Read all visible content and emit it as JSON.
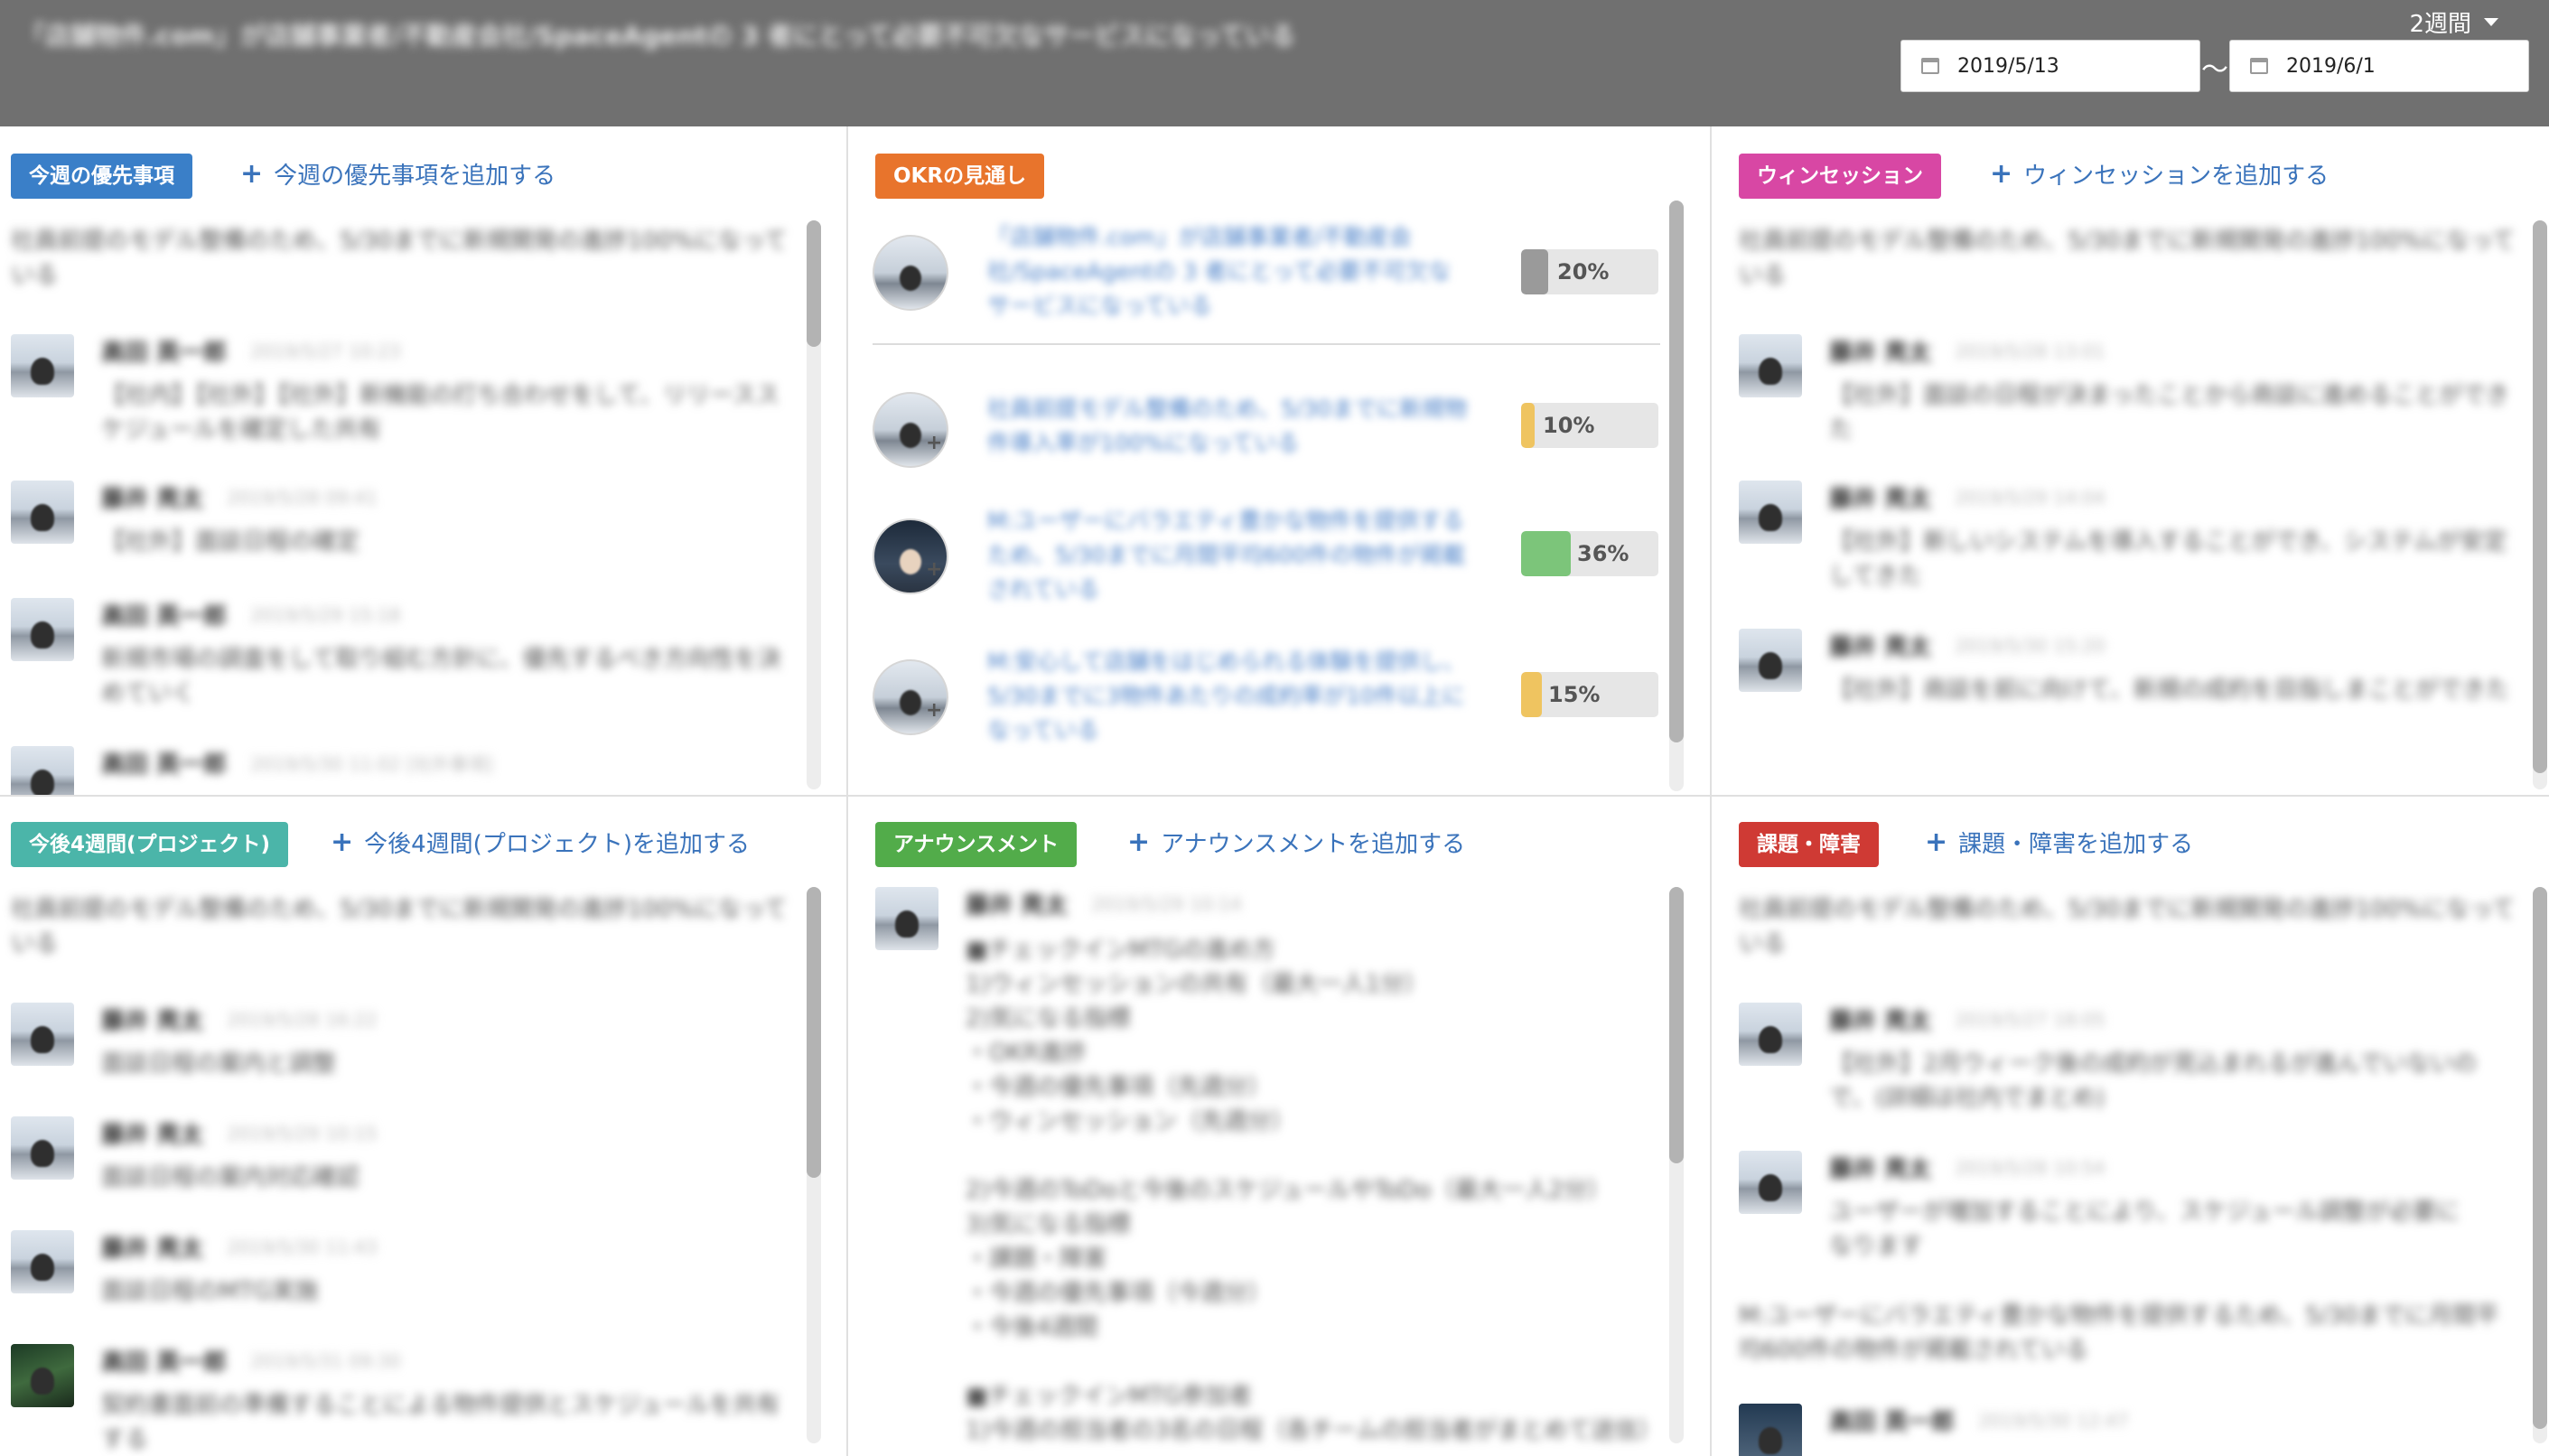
{
  "header": {
    "title": "「店舗物件.com」が店舗事業者/不動産会社/SpaceAgentの 3 者にとって必要不可欠なサービスになっている",
    "period": "2週間",
    "date_from": "2019/5/13",
    "date_separator": "〜",
    "date_to": "2019/6/1"
  },
  "colors": {
    "priority": "#3a7fc8",
    "okr": "#e8742c",
    "winsession": "#d847a4",
    "upcoming": "#4bb5a9",
    "announcement": "#52ac4a",
    "issues": "#cf3a34"
  },
  "panels": {
    "priority": {
      "label": "今週の優先事項",
      "add_label": "今週の優先事項を追加する",
      "intro": "社員前提のモデル整備のため、5/30までに新規開発の進捗100%になっている",
      "items": [
        {
          "name": "高田 英一郎",
          "time": "2019/5/27 10:23",
          "text": "【社内】【社外】【社外】新機能の打ち合わせをして、リリーススケジュールを確定した共有"
        },
        {
          "name": "藤井 亮太",
          "time": "2019/5/28 09:41",
          "text": "【社外】面談日程の確定"
        },
        {
          "name": "高田 英一郎",
          "time": "2019/5/29 15:18",
          "text": "新規市場の調査をして取り組む方針に、優先するべき方向性を決めていく"
        },
        {
          "name": "高田 英一郎",
          "time": "2019/5/30 11:02 [社外事項]",
          "text": ""
        }
      ]
    },
    "okr": {
      "label": "OKRの見通し",
      "main_objective": "「店舗物件.com」が店舗事業者/不動産会社/SpaceAgentの 3 者にとって必要不可欠なサービスになっている",
      "main_progress": "20%",
      "key_results": [
        {
          "text": "社員前提モデル整備のため、5/30までに新規物件導入率が100%になっている",
          "progress": "10%",
          "value": 10,
          "color": "#efc460"
        },
        {
          "text": "M:ユーザーにバラエティ豊かな物件を提供するため、5/30までに月間平均600件の物件が掲載されている",
          "progress": "36%",
          "value": 36,
          "color": "#7cc57a"
        },
        {
          "text": "M:安心して店舗をはじめられる体験を提供し、5/30までに3物件あたりの成約率が10件以上になっている",
          "progress": "15%",
          "value": 15,
          "color": "#efc460"
        }
      ]
    },
    "winsession": {
      "label": "ウィンセッション",
      "add_label": "ウィンセッションを追加する",
      "intro": "社員前提のモデル整備のため、5/30までに新規開発の進捗100%になっている",
      "items": [
        {
          "name": "藤井 亮太",
          "time": "2019/5/28 13:01",
          "text": "【社外】面談の日程が決まったことから商談に進めることができた"
        },
        {
          "name": "藤井 亮太",
          "time": "2019/5/29 14:04",
          "text": "【社外】新しいシステムを導入することができ、システムが安定してきた"
        },
        {
          "name": "藤井 亮太",
          "time": "2019/5/30 15:20",
          "text": "【社外】商談を前に向けて、新規の成約を目指しまことができた"
        }
      ]
    },
    "upcoming": {
      "label": "今後4週間(プロジェクト)",
      "add_label": "今後4週間(プロジェクト)を追加する",
      "intro": "社員前提のモデル整備のため、5/30までに新規開発の進捗100%になっている",
      "items": [
        {
          "name": "藤井 亮太",
          "time": "2019/5/28 16:22",
          "text": "面談日程の案内と調整"
        },
        {
          "name": "藤井 亮太",
          "time": "2019/5/29 10:15",
          "text": "面談日程の案内対応確認"
        },
        {
          "name": "藤井 亮太",
          "time": "2019/5/30 11:43",
          "text": "面談日程のMTG実施"
        },
        {
          "name": "高田 英一郎",
          "time": "2019/5/31 09:30",
          "text": "契約書面前の準備することによる物件提供とスケジュールを共有する"
        }
      ]
    },
    "announcement": {
      "label": "アナウンスメント",
      "add_label": "アナウンスメントを追加する",
      "author": "藤井 亮太",
      "time": "2019/5/29 10:14",
      "lines": [
        "■チェックインMTGの進め方",
        "1)ウィンセッションの共有（最大一人1分）",
        "2)気になる指標",
        "・OKR進捗",
        "・今週の優先事項（先週分）",
        "・ウィンセッション（先週分）",
        "",
        "2)今週のToDoと今後のスケジュールやToDo（最大一人2分）",
        "3)気になる指標",
        "・課題・障害",
        "・今週の優先事項（今週分）",
        "・今後4週間",
        "",
        "■チェックインMTG参加者",
        "1)今週の担当者の3名の日程（各チームの担当者がまとめて送信）"
      ]
    },
    "issues": {
      "label": "課題・障害",
      "add_label": "課題・障害を追加する",
      "intro": "社員前提のモデル整備のため、5/30までに新規開発の進捗100%になっている",
      "items": [
        {
          "name": "藤井 亮太",
          "time": "2019/5/27 18:05",
          "text": "【社外】2月ウィーク後の成約が見込まれるが進んでいないので、(詳細は社内でまとめ)"
        },
        {
          "name": "藤井 亮太",
          "time": "2019/5/28 10:54",
          "text": "ユーザーが増加することにより、スケジュール調整が必要になります"
        }
      ],
      "second_intro": "M:ユーザーにバラエティ豊かな物件を提供するため、5/30までに月間平均600件の物件が掲載されている",
      "last_item": {
        "name": "高田 英一郎",
        "time": "2019/5/30 12:47"
      }
    }
  }
}
